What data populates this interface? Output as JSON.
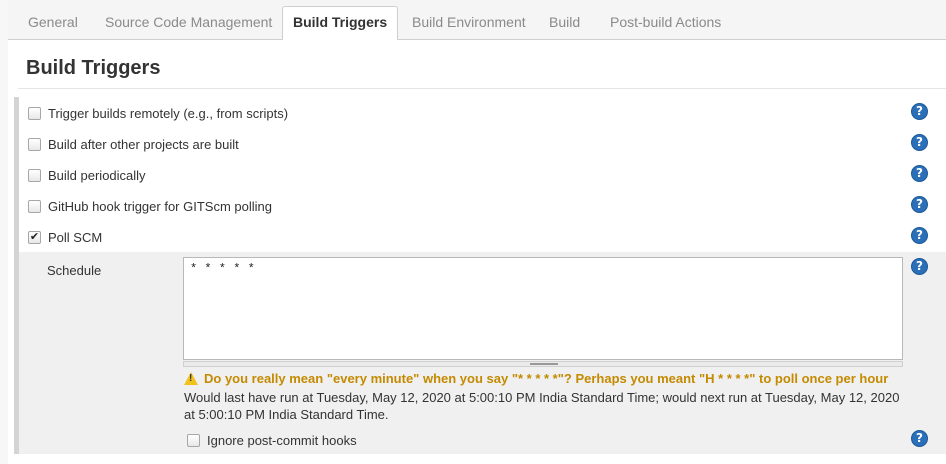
{
  "tabs": [
    {
      "label": "General",
      "active": false
    },
    {
      "label": "Source Code Management",
      "active": false
    },
    {
      "label": "Build Triggers",
      "active": true
    },
    {
      "label": "Build Environment",
      "active": false
    },
    {
      "label": "Build",
      "active": false
    },
    {
      "label": "Post-build Actions",
      "active": false
    }
  ],
  "section": {
    "title": "Build Triggers"
  },
  "triggers": [
    {
      "label": "Trigger builds remotely (e.g., from scripts)",
      "checked": false
    },
    {
      "label": "Build after other projects are built",
      "checked": false
    },
    {
      "label": "Build periodically",
      "checked": false
    },
    {
      "label": "GitHub hook trigger for GITScm polling",
      "checked": false
    },
    {
      "label": "Poll SCM",
      "checked": true
    }
  ],
  "schedule": {
    "label": "Schedule",
    "value": "* * * * *",
    "warning": "Do you really mean \"every minute\" when you say \"* * * * *\"? Perhaps you meant \"H * * * *\" to poll once per hour",
    "info": "Would last have run at Tuesday, May 12, 2020 at 5:00:10 PM India Standard Time; would next run at Tuesday, May 12, 2020 at 5:00:10 PM India Standard Time."
  },
  "ignore_hooks": {
    "label": "Ignore post-commit hooks",
    "checked": false
  },
  "help_glyph": "?",
  "colors": {
    "accent": "#2a6fb7",
    "warning": "#c48a00"
  }
}
